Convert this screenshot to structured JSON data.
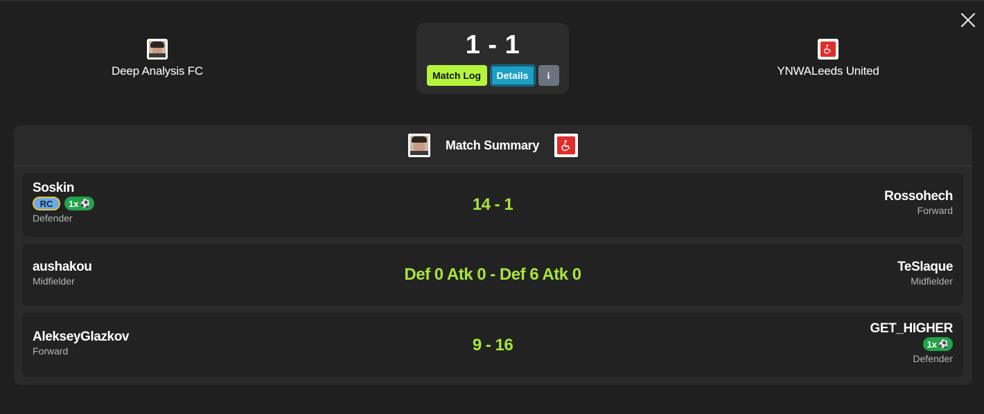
{
  "header": {
    "home_team": {
      "name": "Deep Analysis FC",
      "logo": "profile-photo-logo"
    },
    "away_team": {
      "name": "YNWALeeds United",
      "logo": "red-accessibility-logo"
    },
    "score": "1 - 1",
    "buttons": {
      "match_log": "Match Log",
      "details": "Details",
      "info": "i"
    },
    "close_icon": "close-icon"
  },
  "summary": {
    "title": "Match Summary",
    "rows": [
      {
        "left": {
          "name": "Soskin",
          "position": "Defender",
          "badges": [
            "RC",
            "1x"
          ]
        },
        "score": "14 - 1",
        "right": {
          "name": "Rossohech",
          "position": "Forward",
          "badges": []
        }
      },
      {
        "left": {
          "name": "aushakou",
          "position": "Midfielder",
          "badges": []
        },
        "score": "Def 0 Atk 0 - Def 6 Atk 0",
        "right": {
          "name": "TeSlaque",
          "position": "Midfielder",
          "badges": []
        }
      },
      {
        "left": {
          "name": "AlekseyGlazkov",
          "position": "Forward",
          "badges": []
        },
        "score": "9 - 16",
        "right": {
          "name": "GET_HIGHER",
          "position": "Defender",
          "badges": [
            "1x"
          ]
        }
      }
    ]
  },
  "colors": {
    "background": "#1f1f1f",
    "panel": "#2a2a2a",
    "row": "#222222",
    "accent_green": "#a8e63a",
    "match_log_btn": "#b5f43c",
    "details_btn": "#1d9fc4",
    "info_btn": "#6b7280",
    "rc_badge": "#6aa9e6",
    "goal_badge": "#22a34a"
  }
}
